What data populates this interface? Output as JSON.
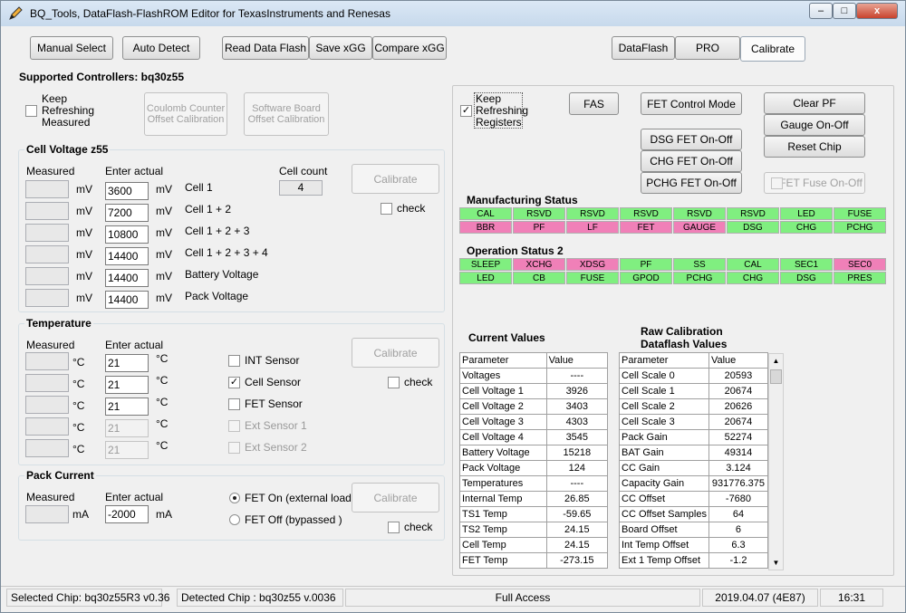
{
  "window": {
    "title": "BQ_Tools,   DataFlash-FlashROM Editor    for TexasInstruments and Renesas",
    "min_label": "–",
    "max_label": "□",
    "close_label": "x"
  },
  "toolbar": {
    "manual_select": "Manual Select",
    "auto_detect": "Auto Detect",
    "read_data_flash": "Read Data Flash",
    "save_xgg": "Save xGG",
    "compare_xgg": "Compare xGG"
  },
  "tabs": {
    "dataflash": "DataFlash",
    "pro": "PRO",
    "calibrate": "Calibrate"
  },
  "supported": {
    "label": "Supported Controllers: bq30z55",
    "keep_refreshing": [
      "Keep",
      "Refreshing",
      "Measured"
    ],
    "coulomb_btn": [
      "Coulomb Counter",
      "Offset Calibration"
    ],
    "software_btn": [
      "Software Board",
      "Offset Calibration"
    ]
  },
  "cell_voltage": {
    "title": "Cell Voltage z55",
    "measured_hdr": "Measured",
    "enter_hdr": "Enter actual",
    "cell_count_label": "Cell count",
    "cell_count": "4",
    "calibrate": "Calibrate",
    "check": "check",
    "unit": "mV",
    "rows": [
      {
        "actual": "3600",
        "name": "Cell 1"
      },
      {
        "actual": "7200",
        "name": "Cell 1 + 2"
      },
      {
        "actual": "10800",
        "name": "Cell 1 + 2 + 3"
      },
      {
        "actual": "14400",
        "name": "Cell 1 + 2 + 3 + 4"
      },
      {
        "actual": "14400",
        "name": "Battery  Voltage"
      },
      {
        "actual": "14400",
        "name": "Pack    Voltage"
      }
    ]
  },
  "temperature": {
    "title": "Temperature",
    "measured_hdr": "Measured",
    "enter_hdr": "Enter actual",
    "unit": "°C",
    "calibrate": "Calibrate",
    "check": "check",
    "rows": [
      {
        "actual": "21",
        "sensor": "INT Sensor",
        "checked": false,
        "enabled": true
      },
      {
        "actual": "21",
        "sensor": "Cell Sensor",
        "checked": true,
        "enabled": true
      },
      {
        "actual": "21",
        "sensor": "FET Sensor",
        "checked": false,
        "enabled": true
      },
      {
        "actual": "21",
        "sensor": "Ext Sensor 1",
        "checked": false,
        "enabled": false
      },
      {
        "actual": "21",
        "sensor": "Ext Sensor 2",
        "checked": false,
        "enabled": false
      }
    ]
  },
  "pack_current": {
    "title": "Pack Current",
    "measured_hdr": "Measured",
    "enter_hdr": "Enter actual",
    "unit": "mA",
    "actual": "-2000",
    "fet_on": "FET On (external load)",
    "fet_off": "FET Off (bypassed     )",
    "calibrate": "Calibrate",
    "check": "check"
  },
  "right": {
    "keep_refreshing": [
      "Keep",
      "Refreshing",
      "Registers"
    ],
    "fas": "FAS",
    "fet_control_mode": "FET Control Mode",
    "dsg": "DSG   FET  On-Off",
    "chg": "CHG   FET  On-Off",
    "pchg": "PCHG  FET  On-Off",
    "clear_pf": "Clear PF",
    "gauge_on_off": "Gauge On-Off",
    "reset_chip": "Reset Chip",
    "fet_fuse": "FET Fuse On-Off",
    "mfg_title": "Manufacturing Status",
    "mfg_row1": [
      "CAL",
      "RSVD",
      "RSVD",
      "RSVD",
      "RSVD",
      "RSVD",
      "LED",
      "FUSE"
    ],
    "mfg_row1_colors": [
      "g",
      "g",
      "g",
      "g",
      "g",
      "g",
      "g",
      "g"
    ],
    "mfg_row2": [
      "BBR",
      "PF",
      "LF",
      "FET",
      "GAUGE",
      "DSG",
      "CHG",
      "PCHG"
    ],
    "mfg_row2_colors": [
      "p",
      "p",
      "p",
      "p",
      "p",
      "g",
      "g",
      "g"
    ],
    "op_title": "Operation Status 2",
    "op_row1": [
      "SLEEP",
      "XCHG",
      "XDSG",
      "PF",
      "SS",
      "CAL",
      "SEC1",
      "SEC0"
    ],
    "op_row1_colors": [
      "g",
      "p",
      "p",
      "g",
      "g",
      "g",
      "g",
      "p"
    ],
    "op_row2": [
      "LED",
      "CB",
      "FUSE",
      "GPOD",
      "PCHG",
      "CHG",
      "DSG",
      "PRES"
    ],
    "op_row2_colors": [
      "g",
      "g",
      "g",
      "g",
      "g",
      "g",
      "g",
      "g"
    ],
    "current_title": "Current Values",
    "raw_title": [
      "Raw    Calibration",
      "Dataflash  Values"
    ],
    "col_param": "Parameter",
    "col_value": "Value",
    "current_rows": [
      [
        "Voltages",
        "----"
      ],
      [
        "Cell Voltage 1",
        "3926"
      ],
      [
        "Cell Voltage 2",
        "3403"
      ],
      [
        "Cell Voltage 3",
        "4303"
      ],
      [
        "Cell Voltage 4",
        "3545"
      ],
      [
        "Battery Voltage",
        "15218"
      ],
      [
        "Pack Voltage",
        "124"
      ],
      [
        "Temperatures",
        "----"
      ],
      [
        "Internal Temp",
        "26.85"
      ],
      [
        "TS1 Temp",
        "-59.65"
      ],
      [
        "TS2 Temp",
        "24.15"
      ],
      [
        "Cell Temp",
        "24.15"
      ],
      [
        "FET Temp",
        "-273.15"
      ]
    ],
    "raw_rows": [
      [
        "Cell Scale 0",
        "20593"
      ],
      [
        "Cell Scale 1",
        "20674"
      ],
      [
        "Cell Scale 2",
        "20626"
      ],
      [
        "Cell Scale 3",
        "20674"
      ],
      [
        "Pack Gain",
        "52274"
      ],
      [
        "BAT Gain",
        "49314"
      ],
      [
        "CC Gain",
        "3.124"
      ],
      [
        "Capacity Gain",
        "931776.375"
      ],
      [
        "CC Offset",
        "-7680"
      ],
      [
        "CC Offset Samples",
        "64"
      ],
      [
        "Board Offset",
        "6"
      ],
      [
        "Int Temp Offset",
        "6.3"
      ],
      [
        "Ext 1 Temp Offset",
        "-1.2"
      ]
    ]
  },
  "statusbar": {
    "selected_chip": "Selected Chip:  bq30z55R3 v0.36",
    "detected_chip": "Detected Chip : bq30z55  v.0036",
    "access": "Full Access",
    "date": "2019.04.07  (4E87)",
    "time": "16:31"
  }
}
